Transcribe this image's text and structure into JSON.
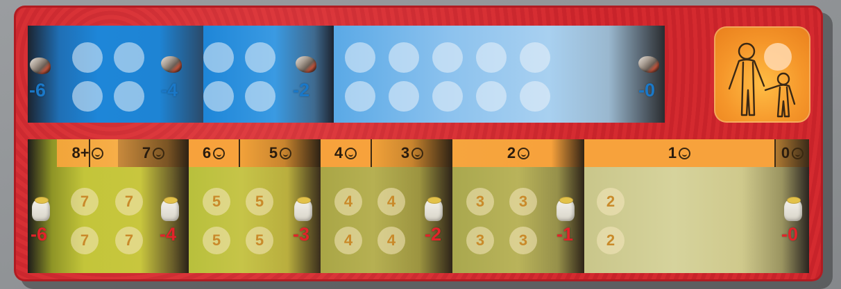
{
  "stone_track": {
    "icon": "stone-icon",
    "penalties": [
      "-6",
      "-4",
      "-2",
      "-0"
    ],
    "colors": {
      "number": "#1a78c8",
      "panel_light": "#9fc9ef",
      "panel_dark": "#1e82d6"
    }
  },
  "family_tile": {
    "icon": "parent-child-icon",
    "color": "#f5962a"
  },
  "grain_track": {
    "icon": "grain-sack-icon",
    "headers": [
      "8+",
      "7",
      "6",
      "5",
      "4",
      "3",
      "2",
      "1",
      "0"
    ],
    "slot_values": {
      "seg1": [
        "7",
        "7",
        "7",
        "7"
      ],
      "seg2": [
        "5",
        "5",
        "5",
        "5"
      ],
      "seg3": [
        "4",
        "4",
        "4",
        "4"
      ],
      "seg4": [
        "3",
        "3",
        "3",
        "3"
      ],
      "seg5": [
        "2",
        "2"
      ]
    },
    "penalties": [
      "-6",
      "-4",
      "-3",
      "-2",
      "-1",
      "-0"
    ],
    "colors": {
      "number": "#e2232a",
      "header": "#f7a23c",
      "slot_number": "#c98a2a"
    }
  }
}
